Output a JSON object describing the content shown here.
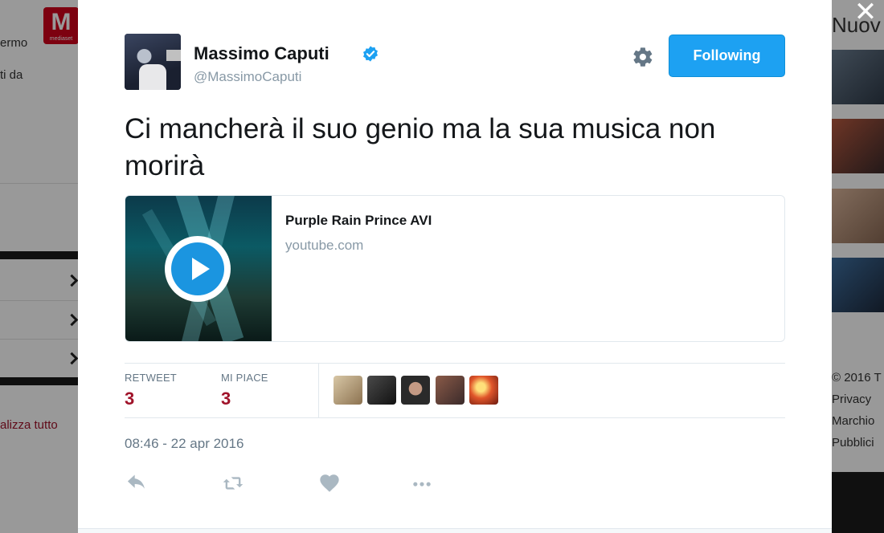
{
  "background": {
    "left": {
      "logo_letter": "M",
      "logo_caption": "mediaset",
      "text_1": "ermo",
      "text_2": "ti da",
      "footer_link": "alizza tutto"
    },
    "right": {
      "heading": "Nuov",
      "footer": [
        "© 2016 T",
        "Privacy",
        "Marchio",
        "Pubblici"
      ]
    }
  },
  "modal": {
    "close_label": "✕",
    "author": {
      "display_name": "Massimo Caputi",
      "handle": "@MassimoCaputi",
      "verified": true
    },
    "follow_button": "Following",
    "tweet_text": "Ci mancherà il suo genio ma la sua musica non morirà",
    "card": {
      "title": "Purple Rain Prince AVI",
      "domain": "youtube.com"
    },
    "stats": {
      "retweets_label": "RETWEET",
      "retweets_value": "3",
      "likes_label": "MI PIACE",
      "likes_value": "3"
    },
    "timestamp": "08:46 - 22 apr 2016",
    "actions": [
      "reply-icon",
      "retweet-icon",
      "heart-icon",
      "more-icon"
    ]
  },
  "colors": {
    "accent": "#1da1f2",
    "stat_value": "#a0132a",
    "muted": "#657786"
  }
}
